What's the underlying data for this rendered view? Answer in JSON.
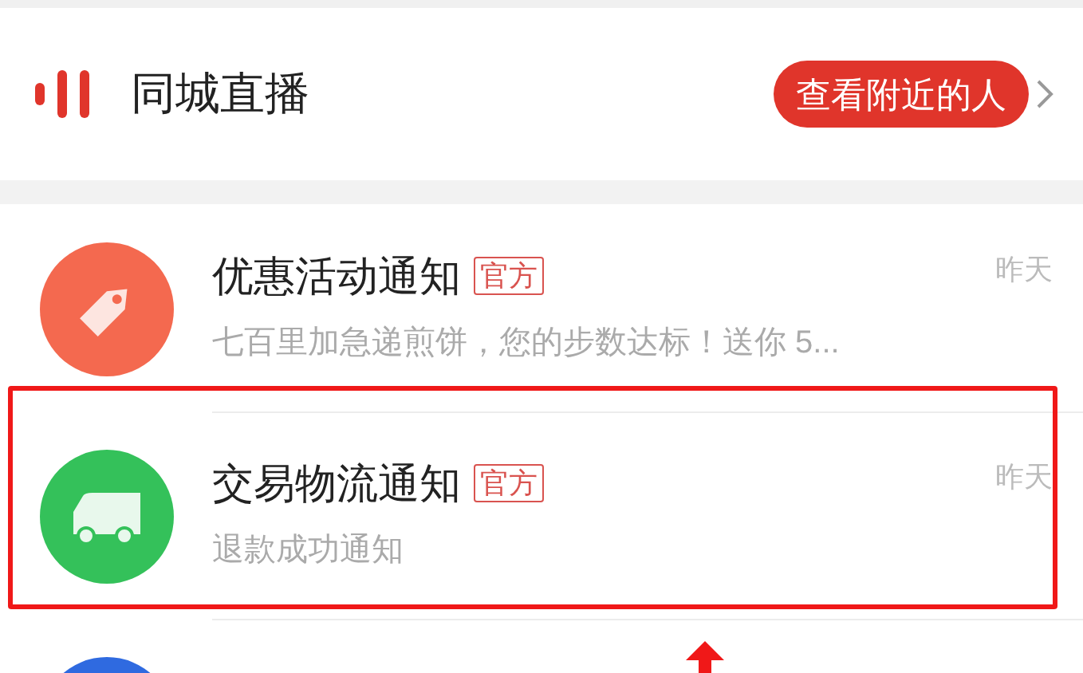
{
  "header": {
    "title": "同城直播",
    "button": "查看附近的人"
  },
  "messages": [
    {
      "kind": "tag",
      "color": "#f4694f",
      "title": "优惠活动通知",
      "tag": "官方",
      "preview": "七百里加急递煎饼，您的步数达标！送你 5...",
      "time": "昨天",
      "highlighted": false
    },
    {
      "kind": "truck",
      "color": "#34c15a",
      "title": "交易物流通知",
      "tag": "官方",
      "preview": "退款成功通知",
      "time": "昨天",
      "highlighted": true
    },
    {
      "kind": "blank",
      "color": "#2f6ae0",
      "highlighted": false
    }
  ]
}
